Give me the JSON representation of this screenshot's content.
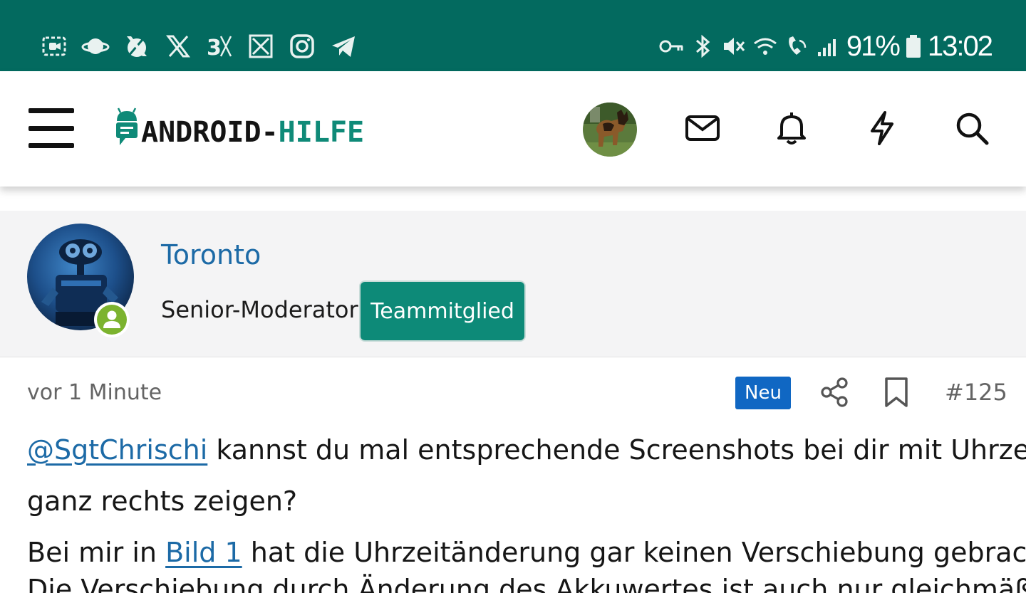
{
  "status_bar": {
    "left_icons": [
      "screen-record-icon",
      "saturn-app-icon",
      "x-app-icon",
      "x-app-icon",
      "threads-icon",
      "x-box-icon",
      "instagram-icon",
      "telegram-icon"
    ],
    "battery_percent": "91%",
    "time": "13:02",
    "background_color": "#036a5f"
  },
  "header": {
    "logo_part1": "ANDROID-",
    "logo_part2": "HILFE",
    "brand_color": "#0f8a78"
  },
  "poster": {
    "name": "Toronto",
    "role": "Senior-Moderator",
    "badge": "Teammitglied"
  },
  "post": {
    "time": "vor 1 Minute",
    "new_badge": "Neu",
    "number": "#125",
    "mention": "@SgtChrischi",
    "line1_rest": " kannst du mal entsprechende Screenshots bei dir mit Uhrzeit",
    "line2": "ganz rechts zeigen?",
    "line3_pre": "Bei mir in ",
    "line3_link": "Bild 1",
    "line3_post": " hat die Uhrzeitänderung gar keinen Verschiebung gebracht.",
    "line4_partial": "Die Verschiebung durch Änderung des Akkuwertes ist auch nur gleichmäßig"
  }
}
